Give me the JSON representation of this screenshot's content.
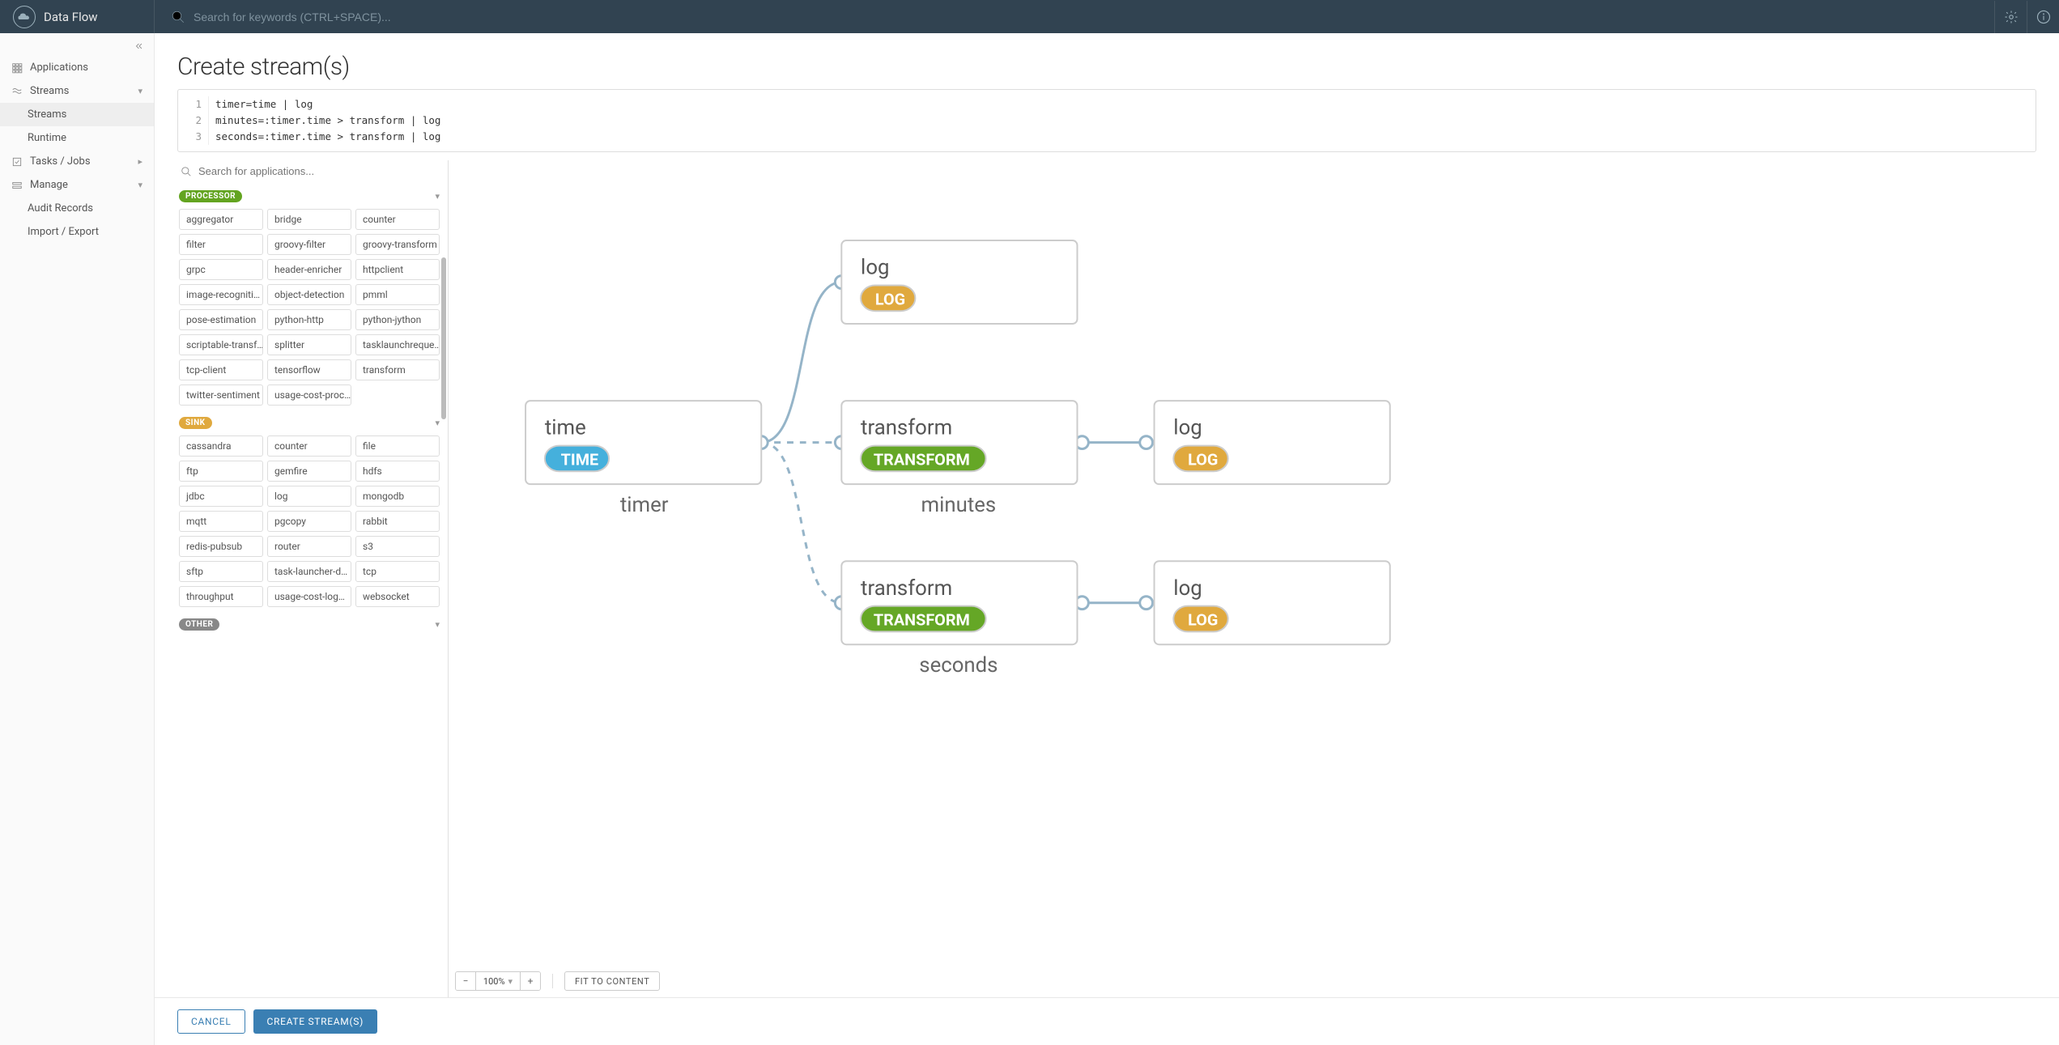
{
  "brand": "Data Flow",
  "top_search_placeholder": "Search for keywords (CTRL+SPACE)...",
  "sidebar": {
    "items": [
      {
        "label": "Applications",
        "icon": "apps"
      },
      {
        "label": "Streams",
        "icon": "streams",
        "expandable": true,
        "open": true
      },
      {
        "label": "Streams",
        "sub": true,
        "active": true
      },
      {
        "label": "Runtime",
        "sub": true
      },
      {
        "label": "Tasks / Jobs",
        "icon": "tasks",
        "expandable": true
      },
      {
        "label": "Manage",
        "icon": "manage",
        "expandable": true,
        "open": true
      },
      {
        "label": "Audit Records",
        "sub": true
      },
      {
        "label": "Import / Export",
        "sub": true
      }
    ]
  },
  "page": {
    "title": "Create stream(s)"
  },
  "code": {
    "lines": [
      "timer=time | log",
      "minutes=:timer.time > transform | log",
      "seconds=:timer.time > transform | log"
    ]
  },
  "palette": {
    "search_placeholder": "Search for applications...",
    "sections": [
      {
        "label": "PROCESSOR",
        "class": "processor",
        "items": [
          "aggregator",
          "bridge",
          "counter",
          "filter",
          "groovy-filter",
          "groovy-transform",
          "grpc",
          "header-enricher",
          "httpclient",
          "image-recogniti…",
          "object-detection",
          "pmml",
          "pose-estimation",
          "python-http",
          "python-jython",
          "scriptable-transf…",
          "splitter",
          "tasklaunchreque…",
          "tcp-client",
          "tensorflow",
          "transform",
          "twitter-sentiment",
          "usage-cost-proc…"
        ]
      },
      {
        "label": "SINK",
        "class": "sink",
        "items": [
          "cassandra",
          "counter",
          "file",
          "ftp",
          "gemfire",
          "hdfs",
          "jdbc",
          "log",
          "mongodb",
          "mqtt",
          "pgcopy",
          "rabbit",
          "redis-pubsub",
          "router",
          "s3",
          "sftp",
          "task-launcher-d…",
          "tcp",
          "throughput",
          "usage-cost-log…",
          "websocket"
        ]
      },
      {
        "label": "OTHER",
        "class": "other",
        "items": []
      }
    ]
  },
  "canvas": {
    "zoom": "100%",
    "fit_label": "FIT TO CONTENT",
    "nodes": [
      {
        "id": "time",
        "title": "time",
        "badge": "TIME",
        "btype": "time",
        "group": "timer"
      },
      {
        "id": "log1",
        "title": "log",
        "badge": "LOG",
        "btype": "log"
      },
      {
        "id": "t1",
        "title": "transform",
        "badge": "TRANSFORM",
        "btype": "transform",
        "group": "minutes"
      },
      {
        "id": "log2",
        "title": "log",
        "badge": "LOG",
        "btype": "log"
      },
      {
        "id": "t2",
        "title": "transform",
        "badge": "TRANSFORM",
        "btype": "transform",
        "group": "seconds"
      },
      {
        "id": "log3",
        "title": "log",
        "badge": "LOG",
        "btype": "log"
      }
    ],
    "groups": {
      "timer": "timer",
      "minutes": "minutes",
      "seconds": "seconds"
    }
  },
  "footer": {
    "cancel": "CANCEL",
    "create": "CREATE STREAM(S)"
  }
}
